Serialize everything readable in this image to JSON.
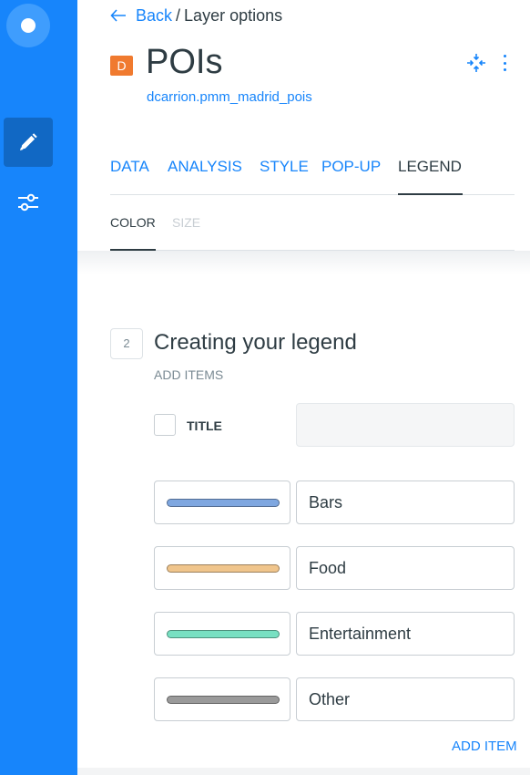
{
  "colors": {
    "sidebar_bg": "#1785fb",
    "accent": "#1785fb",
    "badge": "#f07a2f",
    "text": "#2e3c43"
  },
  "sidebar": {
    "items": [
      {
        "icon": "pencil-icon",
        "active": true
      },
      {
        "icon": "sliders-icon",
        "active": false
      }
    ]
  },
  "breadcrumb": {
    "back_label": "Back",
    "separator": "/",
    "current": "Layer options"
  },
  "layer": {
    "badge": "D",
    "title": "POIs",
    "subtitle": "dcarrion.pmm_madrid_pois"
  },
  "tabs": [
    {
      "label": "DATA",
      "active": false
    },
    {
      "label": "ANALYSIS",
      "active": false
    },
    {
      "label": "STYLE",
      "active": false
    },
    {
      "label": "POP-UP",
      "active": false
    },
    {
      "label": "LEGEND",
      "active": true
    }
  ],
  "subtabs": [
    {
      "label": "COLOR",
      "active": true
    },
    {
      "label": "SIZE",
      "active": false
    }
  ],
  "step": {
    "number": "2",
    "title": "Creating your legend",
    "subtitle": "ADD ITEMS"
  },
  "title_option": {
    "label": "TITLE",
    "checked": false,
    "value": ""
  },
  "legend_items": [
    {
      "label": "Bars",
      "color": "#7fa7e0"
    },
    {
      "label": "Food",
      "color": "#f0c58c"
    },
    {
      "label": "Entertainment",
      "color": "#78e0c2"
    },
    {
      "label": "Other",
      "color": "#9a9a9a"
    }
  ],
  "add_item_label": "ADD ITEM"
}
